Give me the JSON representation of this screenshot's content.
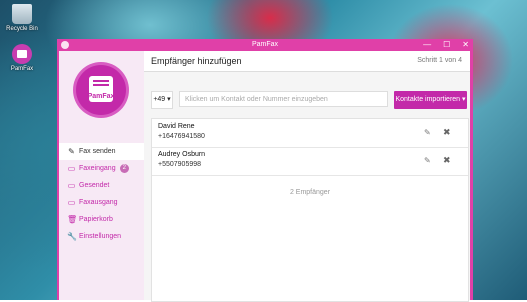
{
  "desktop": {
    "icons": [
      {
        "label": "Recycle Bin"
      },
      {
        "label": "PamFax"
      }
    ]
  },
  "window": {
    "title": "PamFax",
    "controls": {
      "minimize": "—",
      "maximize": "☐",
      "close": "✕"
    }
  },
  "logo": {
    "text": "PamFax"
  },
  "nav": [
    {
      "label": "Fax senden",
      "icon": "pencil-square-icon",
      "glyph": "✎"
    },
    {
      "label": "Faxeingang",
      "icon": "folder-open-icon",
      "glyph": "▭",
      "badge": "2"
    },
    {
      "label": "Gesendet",
      "icon": "folder-icon",
      "glyph": "▭"
    },
    {
      "label": "Faxausgang",
      "icon": "folder-icon",
      "glyph": "▭"
    },
    {
      "label": "Papierkorb",
      "icon": "trash-icon",
      "glyph": "🗑"
    },
    {
      "label": "Einstellungen",
      "icon": "wrench-icon",
      "glyph": "🔧"
    }
  ],
  "header": {
    "title": "Empfänger hinzufügen",
    "step": "Schritt 1 von 4"
  },
  "input": {
    "country_code": "+49 ▾",
    "placeholder": "Klicken um Kontakt oder Nummer einzugeben",
    "import_label": "Kontakte importieren ▾"
  },
  "recipients": [
    {
      "name": "David Rene",
      "number": "+16476941580"
    },
    {
      "name": "Audrey Osburn",
      "number": "+5507905998"
    }
  ],
  "recipient_count": "2 Empfänger",
  "colors": {
    "accent": "#c329a9",
    "titlebar": "#e040a8"
  }
}
